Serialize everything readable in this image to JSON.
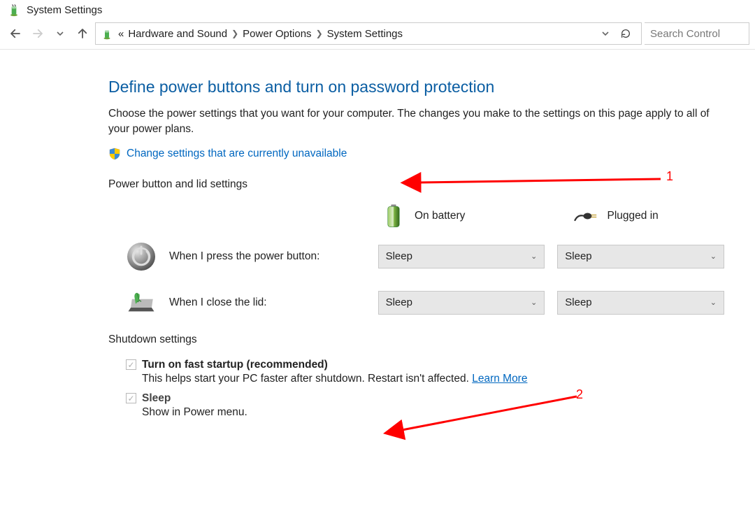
{
  "titlebar": {
    "title": "System Settings"
  },
  "nav": {
    "crumb_ellipsis": "«",
    "crumb1": "Hardware and Sound",
    "crumb2": "Power Options",
    "crumb3": "System Settings",
    "search_placeholder": "Search Control"
  },
  "main": {
    "heading": "Define power buttons and turn on password protection",
    "description": "Choose the power settings that you want for your computer. The changes you make to the settings on this page apply to all of your power plans.",
    "admin_link": "Change settings that are currently unavailable",
    "section_power_lid": "Power button and lid settings",
    "col_battery": "On battery",
    "col_plugged": "Plugged in",
    "row_power_button": "When I press the power button:",
    "row_close_lid": "When I close the lid:",
    "dd_power_battery": "Sleep",
    "dd_power_plugged": "Sleep",
    "dd_lid_battery": "Sleep",
    "dd_lid_plugged": "Sleep",
    "section_shutdown": "Shutdown settings",
    "sd_fast_title": "Turn on fast startup (recommended)",
    "sd_fast_desc": "This helps start your PC faster after shutdown. Restart isn't affected. ",
    "sd_fast_learn": "Learn More",
    "sd_sleep_title": "Sleep",
    "sd_sleep_desc": "Show in Power menu."
  },
  "annotations": {
    "one": "1",
    "two": "2"
  }
}
